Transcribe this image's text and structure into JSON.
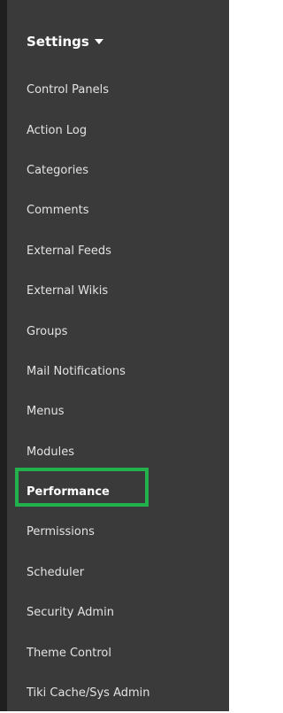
{
  "settings": {
    "title": "Settings",
    "caret_icon": "caret-down-icon"
  },
  "menu": {
    "items": [
      {
        "label": "Control Panels"
      },
      {
        "label": "Action Log"
      },
      {
        "label": "Categories"
      },
      {
        "label": "Comments"
      },
      {
        "label": "External Feeds"
      },
      {
        "label": "External Wikis"
      },
      {
        "label": "Groups"
      },
      {
        "label": "Mail Notifications"
      },
      {
        "label": "Menus"
      },
      {
        "label": "Modules"
      },
      {
        "label": "Performance"
      },
      {
        "label": "Permissions"
      },
      {
        "label": "Scheduler"
      },
      {
        "label": "Security Admin"
      },
      {
        "label": "Theme Control"
      },
      {
        "label": "Tiki Cache/Sys Admin"
      }
    ],
    "highlighted": "Performance"
  },
  "colors": {
    "sidebar_bg": "#3a3a3a",
    "highlight": "#22b14c"
  }
}
